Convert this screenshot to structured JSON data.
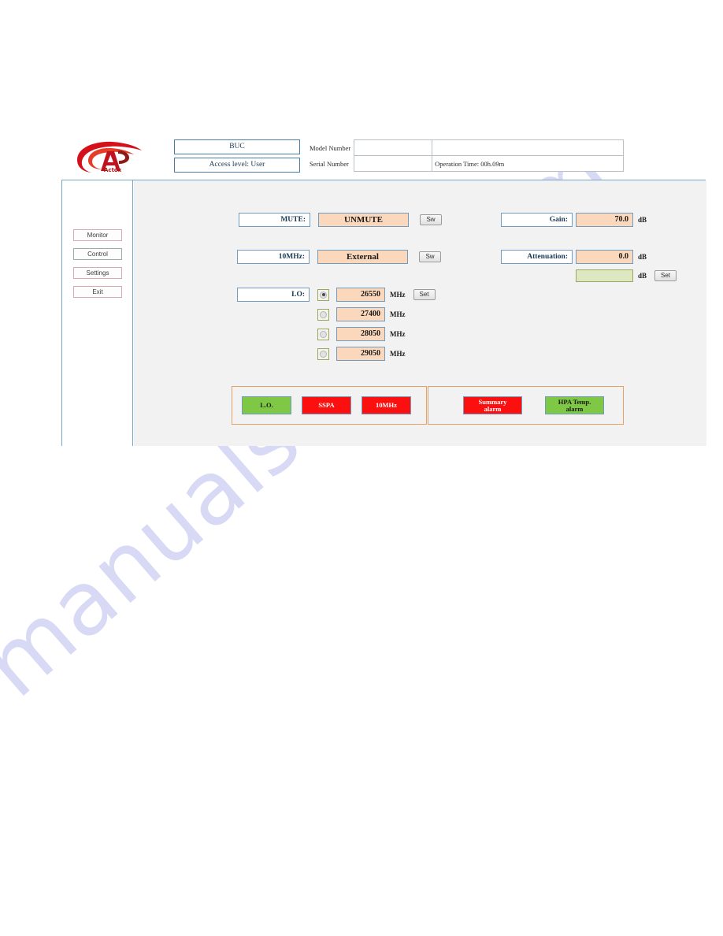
{
  "watermark": {
    "text": "manualshive.com"
  },
  "header": {
    "device_label": "BUC",
    "access_level": "Access level: User",
    "model_number_label": "Model Number",
    "serial_number_label": "Serial Number",
    "model_number_value": "",
    "model_number_extra": "",
    "serial_number_value": "",
    "operation_time": "Operation Time: 00h.09m"
  },
  "sidebar": {
    "items": [
      {
        "label": "Monitor"
      },
      {
        "label": "Control"
      },
      {
        "label": "Settings"
      },
      {
        "label": "Exit"
      }
    ]
  },
  "controls": {
    "mute": {
      "label": "MUTE:",
      "value": "UNMUTE",
      "button": "Sw"
    },
    "ref10mhz": {
      "label": "10MHz:",
      "value": "External",
      "button": "Sw"
    },
    "lo": {
      "label": "LO:",
      "unit": "MHz",
      "button": "Set",
      "selected_index": 0,
      "options": [
        {
          "value": "26550",
          "selected": true
        },
        {
          "value": "27400",
          "selected": false
        },
        {
          "value": "28050",
          "selected": false
        },
        {
          "value": "29050",
          "selected": false
        }
      ]
    },
    "gain": {
      "label": "Gain:",
      "value": "70.0",
      "unit": "dB"
    },
    "attenuation": {
      "label": "Attenuation:",
      "value": "0.0",
      "unit": "dB",
      "input_value": "",
      "input_unit": "dB",
      "button": "Set"
    }
  },
  "alarms": {
    "left_panel": [
      {
        "label": "L.O.",
        "state": "green"
      },
      {
        "label": "SSPA",
        "state": "red"
      },
      {
        "label": "10MHz",
        "state": "red"
      }
    ],
    "right_panel": [
      {
        "label": "Summary alarm",
        "line1": "Summary",
        "line2": "alarm",
        "state": "red"
      },
      {
        "label": "HPA Temp. alarm",
        "line1": "HPA Temp.",
        "line2": "alarm",
        "state": "green"
      }
    ]
  },
  "colors": {
    "value_box": "#fbd8bb",
    "green_input": "#dde8c2",
    "alarm_green": "#7ec845",
    "alarm_red": "#fb0f0f",
    "panel_border": "#e3a165",
    "frame_border": "#7ba7c7"
  }
}
